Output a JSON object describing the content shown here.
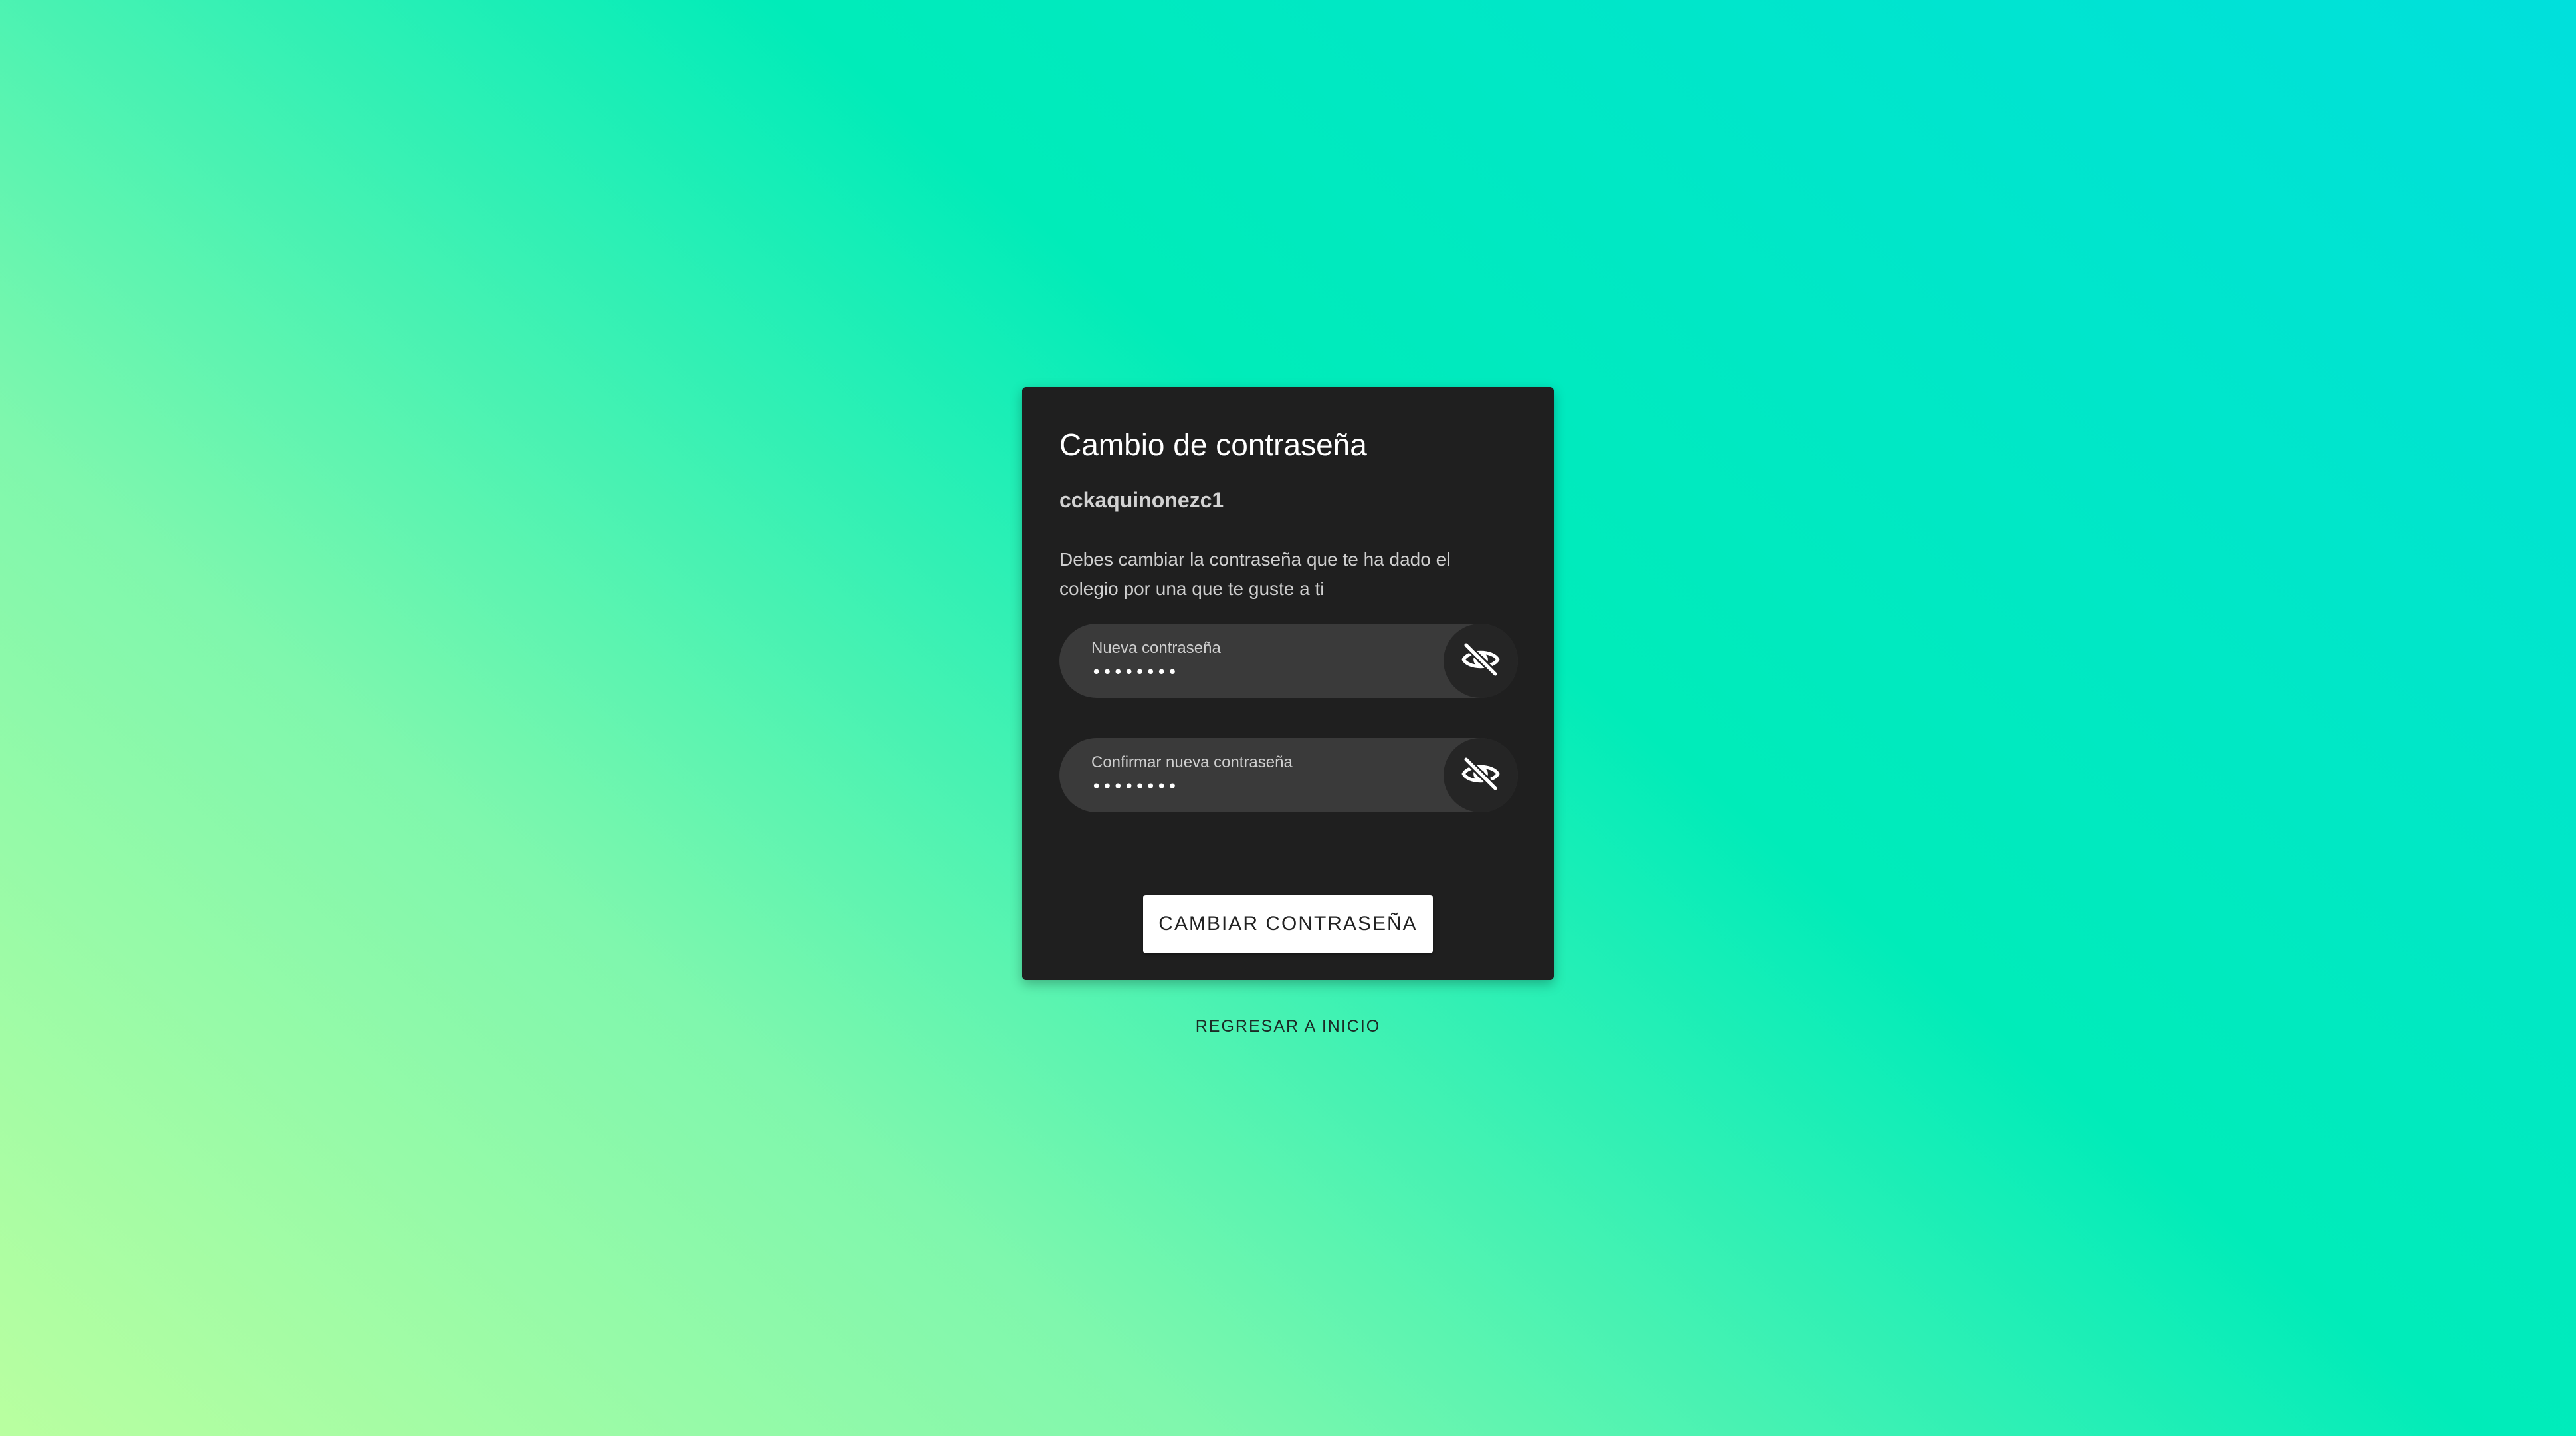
{
  "card": {
    "title": "Cambio de contraseña",
    "username": "cckaquinonezc1",
    "description": "Debes cambiar la contraseña que te ha dado el colegio por una que te guste a ti"
  },
  "fields": [
    {
      "label": "Nueva contraseña",
      "value": "••••••••",
      "toggle_icon": "eye-off-icon"
    },
    {
      "label": "Confirmar nueva contraseña",
      "value": "••••••••",
      "toggle_icon": "eye-off-icon"
    }
  ],
  "actions": {
    "submit_label": "CAMBIAR CONTRASEÑA",
    "back_label": "REGRESAR A INICIO"
  },
  "colors": {
    "card_background": "#1f1f1f",
    "field_background": "#3a3a3a",
    "button_background": "#ffffff",
    "gradient_start": "#b9ffa0",
    "gradient_end": "#00e0dc"
  }
}
